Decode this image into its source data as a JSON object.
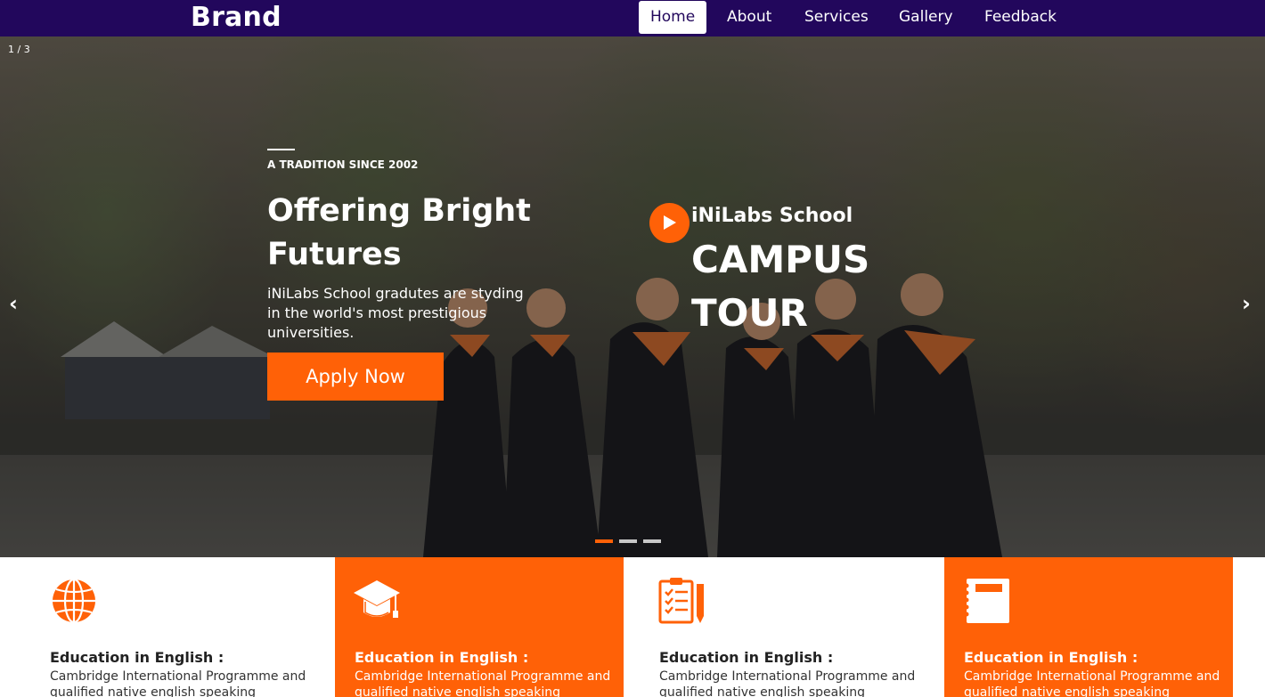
{
  "nav": {
    "brand": "Brand",
    "items": [
      {
        "label": "Home",
        "active": true
      },
      {
        "label": "About"
      },
      {
        "label": "Services"
      },
      {
        "label": "Gallery"
      },
      {
        "label": "Feedback"
      }
    ]
  },
  "hero": {
    "slide_counter": "1 / 3",
    "prev_arrow": "‹",
    "next_arrow": "›",
    "eyebrow": "A TRADITION SINCE 2002",
    "headline": "Offering Bright Futures",
    "subtitle": "iNiLabs School gradutes are styding in the world's most prestigious universities.",
    "cta": "Apply Now",
    "tour": {
      "school": "iNiLabs School",
      "title": "CAMPUS TOUR"
    },
    "active_slide": 1,
    "slide_count": 3
  },
  "features": [
    {
      "icon": "globe-icon",
      "title": "Education in English :",
      "text": "Cambridge International Programme and qualified native english speaking"
    },
    {
      "icon": "graduation-cap-icon",
      "title": "Education in English :",
      "text": "Cambridge International Programme and qualified native english speaking"
    },
    {
      "icon": "checklist-icon",
      "title": "Education in English :",
      "text": "Cambridge International Programme and qualified native english speaking"
    },
    {
      "icon": "notebook-icon",
      "title": "Education in English :",
      "text": "Cambridge International Programme and qualified native english speaking"
    }
  ],
  "colors": {
    "nav_bg": "#22075c",
    "accent": "#ff6107"
  }
}
